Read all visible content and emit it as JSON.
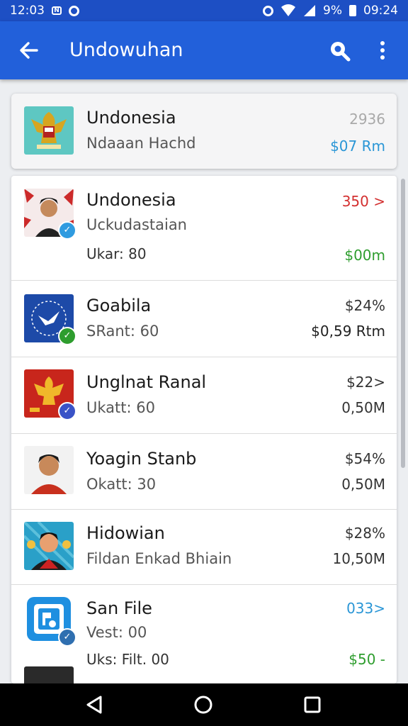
{
  "status_bar": {
    "time_left": "12:03",
    "battery": "9%",
    "time_right": "09:24"
  },
  "app_bar": {
    "title": "Undowuhan"
  },
  "featured": {
    "title": "Undonesia",
    "subtitle": "Ndaaan Hachd",
    "percent": "2936",
    "value": "$07 Rm",
    "colors": {
      "percent": "#a9a9a9",
      "value": "#2a96d6"
    }
  },
  "list": [
    {
      "title": "Undonesia",
      "line2": "Uckudastaian",
      "line3": "Ukar: 80",
      "right_top": "350 >",
      "right_bottom": "$00m",
      "right_top_color": "#d32f2f",
      "right_bottom_color": "#2e9d2e",
      "badge_color": "#2f9be0",
      "badge_icon": "check",
      "thumb": "person-red-flag"
    },
    {
      "title": "Goabila",
      "line2": "SRant: 60",
      "line3": "",
      "right_top": "$24%",
      "right_bottom": "$0,59 Rtm",
      "right_top_color": "#333333",
      "right_bottom_color": "#222222",
      "badge_color": "#2e9d2e",
      "badge_icon": "check",
      "thumb": "blue-bird-logo"
    },
    {
      "title": "Unglnat Ranal",
      "line2": "Ukatt: 60",
      "line3": "",
      "right_top": "$22>",
      "right_bottom": "0,50M",
      "right_top_color": "#333333",
      "right_bottom_color": "#333333",
      "badge_color": "#3a53c7",
      "badge_icon": "check",
      "thumb": "garuda-red"
    },
    {
      "title": "Yoagin Stanb",
      "line2": "Okatt: 30",
      "line3": "",
      "right_top": "$54%",
      "right_bottom": "0,50M",
      "right_top_color": "#333333",
      "right_bottom_color": "#333333",
      "badge_color": "",
      "badge_icon": "",
      "thumb": "person-red-shirt"
    },
    {
      "title": "Hidowian",
      "line2": "Fildan Enkad Bhiain",
      "line3": "",
      "right_top": "$28%",
      "right_bottom": "10,50M",
      "right_top_color": "#333333",
      "right_bottom_color": "#333333",
      "badge_color": "",
      "badge_icon": "",
      "thumb": "person-teal"
    },
    {
      "title": "San File",
      "line2": "Vest: 00",
      "line3": "Uks: Filt. 00",
      "right_top": "033>",
      "right_bottom": "$50 -",
      "right_top_color": "#2a96d6",
      "right_bottom_color": "#2e9d2e",
      "badge_color": "#2f6fb0",
      "badge_icon": "check",
      "thumb": "file-app-icon"
    }
  ],
  "nav": {
    "back": "back-triangle",
    "home": "home-circle",
    "recents": "recents-square"
  }
}
